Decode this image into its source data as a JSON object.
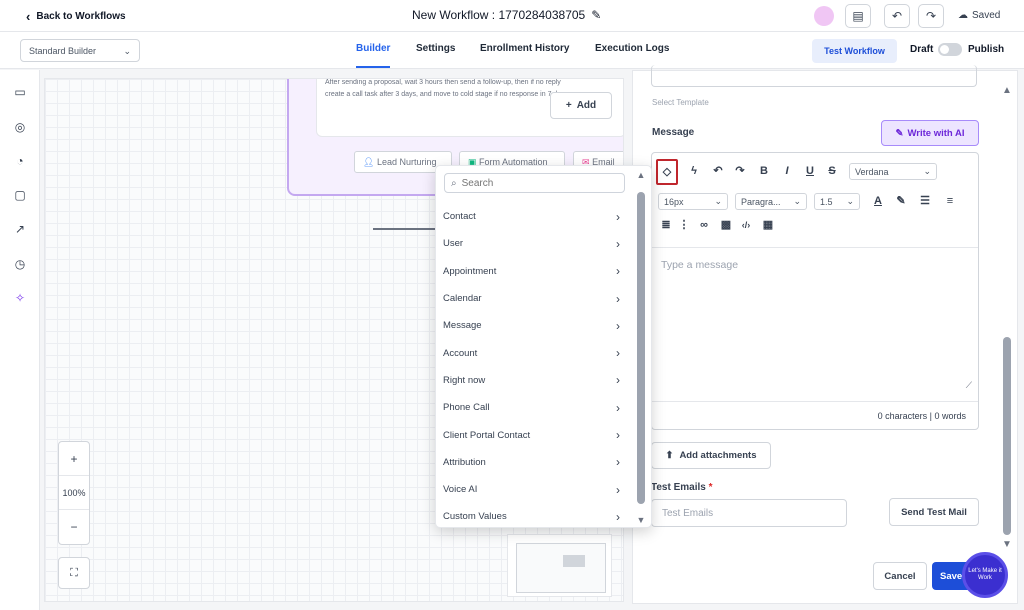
{
  "topbar": {
    "back_label": "Back to Workflows",
    "workflow_title": "New Workflow : 1770284038705",
    "saved_label": "Saved"
  },
  "subbar": {
    "builder_mode": "Standard Builder",
    "tabs": [
      {
        "label": "Builder",
        "active": true
      },
      {
        "label": "Settings",
        "active": false
      },
      {
        "label": "Enrollment History",
        "active": false
      },
      {
        "label": "Execution Logs",
        "active": false
      }
    ],
    "test_workflow_label": "Test Workflow",
    "draft_label": "Draft",
    "publish_label": "Publish"
  },
  "canvas": {
    "node_text_line1": "After sending a proposal, wait 3 hours then send a follow-up, then if no reply",
    "node_text_line2": "create a call task after 3 days, and move to cold stage if no response in 7 days",
    "add_label": "Add",
    "chips": [
      "Lead Nurturing",
      "Form Automation",
      "Email"
    ],
    "zoom_in": "+",
    "zoom_level": "100%",
    "zoom_out": "−"
  },
  "dropdown": {
    "search_placeholder": "Search",
    "items": [
      "Contact",
      "User",
      "Appointment",
      "Calendar",
      "Message",
      "Account",
      "Right now",
      "Phone Call",
      "Client Portal Contact",
      "Attribution",
      "Voice AI",
      "Custom Values"
    ]
  },
  "panel": {
    "template_hint": "Select Template",
    "message_label": "Message",
    "write_ai_label": "Write with AI",
    "font_family": "Verdana",
    "font_size": "16px",
    "paragraph": "Paragra...",
    "line_height": "1.5",
    "message_placeholder": "Type a message",
    "counter": "0 characters | 0 words",
    "add_attachments_label": "Add attachments",
    "test_emails_label": "Test Emails",
    "test_emails_required": "*",
    "test_emails_placeholder": "Test Emails",
    "send_test_label": "Send Test Mail",
    "cancel_label": "Cancel",
    "save_label": "Save",
    "chat_widget_text": "Let's Make it Work"
  },
  "colors": {
    "accent": "#2563eb",
    "ai_purple": "#6d28d9",
    "highlight": "#c0262d"
  }
}
